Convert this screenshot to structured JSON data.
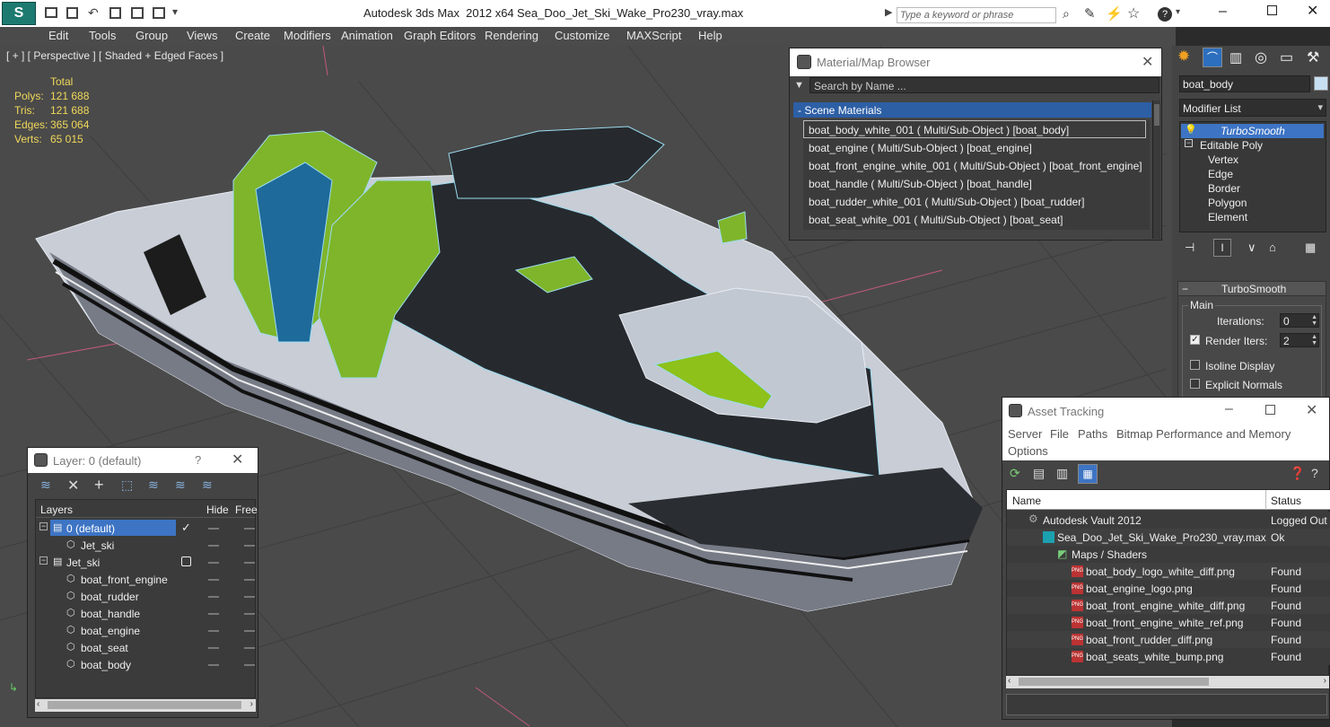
{
  "titlebar": {
    "app_title": "Autodesk 3ds Max  2012 x64",
    "file_title": "Sea_Doo_Jet_Ski_Wake_Pro230_vray.max",
    "search_placeholder": "Type a keyword or phrase"
  },
  "menu": [
    "Edit",
    "Tools",
    "Group",
    "Views",
    "Create",
    "Modifiers",
    "Animation",
    "Graph Editors",
    "Rendering",
    "Customize",
    "MAXScript",
    "Help"
  ],
  "viewport": {
    "label": "[ + ] [ Perspective ] [ Shaded + Edged Faces ]",
    "stats": {
      "header": "Total",
      "rows": [
        {
          "label": "Polys:",
          "value": "121 688"
        },
        {
          "label": "Tris:",
          "value": "121 688"
        },
        {
          "label": "Edges:",
          "value": "365 064"
        },
        {
          "label": "Verts:",
          "value": "65 015"
        }
      ]
    }
  },
  "material_browser": {
    "title": "Material/Map Browser",
    "search_placeholder": "Search by Name ...",
    "group": "- Scene Materials",
    "items": [
      "boat_body_white_001  ( Multi/Sub-Object )  [boat_body]",
      "boat_engine  ( Multi/Sub-Object )  [boat_engine]",
      "boat_front_engine_white_001  ( Multi/Sub-Object )  [boat_front_engine]",
      "boat_handle  ( Multi/Sub-Object )  [boat_handle]",
      "boat_rudder_white_001  ( Multi/Sub-Object )  [boat_rudder]",
      "boat_seat_white_001  ( Multi/Sub-Object )  [boat_seat]"
    ]
  },
  "command_panel": {
    "object_name": "boat_body",
    "modifier_list": "Modifier List",
    "stack": [
      {
        "label": "TurboSmooth",
        "selected": true
      },
      {
        "label": "Editable Poly",
        "selected": false
      },
      {
        "label": "Vertex",
        "selected": false
      },
      {
        "label": "Edge",
        "selected": false
      },
      {
        "label": "Border",
        "selected": false
      },
      {
        "label": "Polygon",
        "selected": false
      },
      {
        "label": "Element",
        "selected": false
      }
    ],
    "rollout_title": "TurboSmooth",
    "group_main": "Main",
    "iterations_label": "Iterations:",
    "iterations_value": "0",
    "render_iters_label": "Render Iters:",
    "render_iters_value": "2",
    "isoline_label": "Isoline Display",
    "explicit_label": "Explicit Normals"
  },
  "layer_dialog": {
    "title": "Layer: 0 (default)",
    "help": "?",
    "col_layers": "Layers",
    "col_hide": "Hide",
    "col_freeze": "Free",
    "rows": [
      {
        "label": "0 (default)",
        "indent": 0,
        "selected": true
      },
      {
        "label": "Jet_ski",
        "indent": 2,
        "selected": false
      },
      {
        "label": "Jet_ski",
        "indent": 0,
        "selected": false
      },
      {
        "label": "boat_front_engine",
        "indent": 2,
        "selected": false
      },
      {
        "label": "boat_rudder",
        "indent": 2,
        "selected": false
      },
      {
        "label": "boat_handle",
        "indent": 2,
        "selected": false
      },
      {
        "label": "boat_engine",
        "indent": 2,
        "selected": false
      },
      {
        "label": "boat_seat",
        "indent": 2,
        "selected": false
      },
      {
        "label": "boat_body",
        "indent": 2,
        "selected": false
      }
    ]
  },
  "asset_tracking": {
    "title": "Asset Tracking",
    "menu": [
      "Server",
      "File",
      "Paths",
      "Bitmap Performance and Memory"
    ],
    "menu2": "Options",
    "col_name": "Name",
    "col_status": "Status",
    "rows": [
      {
        "name": "Autodesk Vault 2012",
        "status": "Logged Out",
        "indent": 0
      },
      {
        "name": "Sea_Doo_Jet_Ski_Wake_Pro230_vray.max",
        "status": "Ok",
        "indent": 1
      },
      {
        "name": "Maps / Shaders",
        "status": "",
        "indent": 2
      },
      {
        "name": "boat_body_logo_white_diff.png",
        "status": "Found",
        "indent": 3
      },
      {
        "name": "boat_engine_logo.png",
        "status": "Found",
        "indent": 3
      },
      {
        "name": "boat_front_engine_white_diff.png",
        "status": "Found",
        "indent": 3
      },
      {
        "name": "boat_front_engine_white_ref.png",
        "status": "Found",
        "indent": 3
      },
      {
        "name": "boat_front_rudder_diff.png",
        "status": "Found",
        "indent": 3
      },
      {
        "name": "boat_seats_white_bump.png",
        "status": "Found",
        "indent": 3
      }
    ]
  }
}
